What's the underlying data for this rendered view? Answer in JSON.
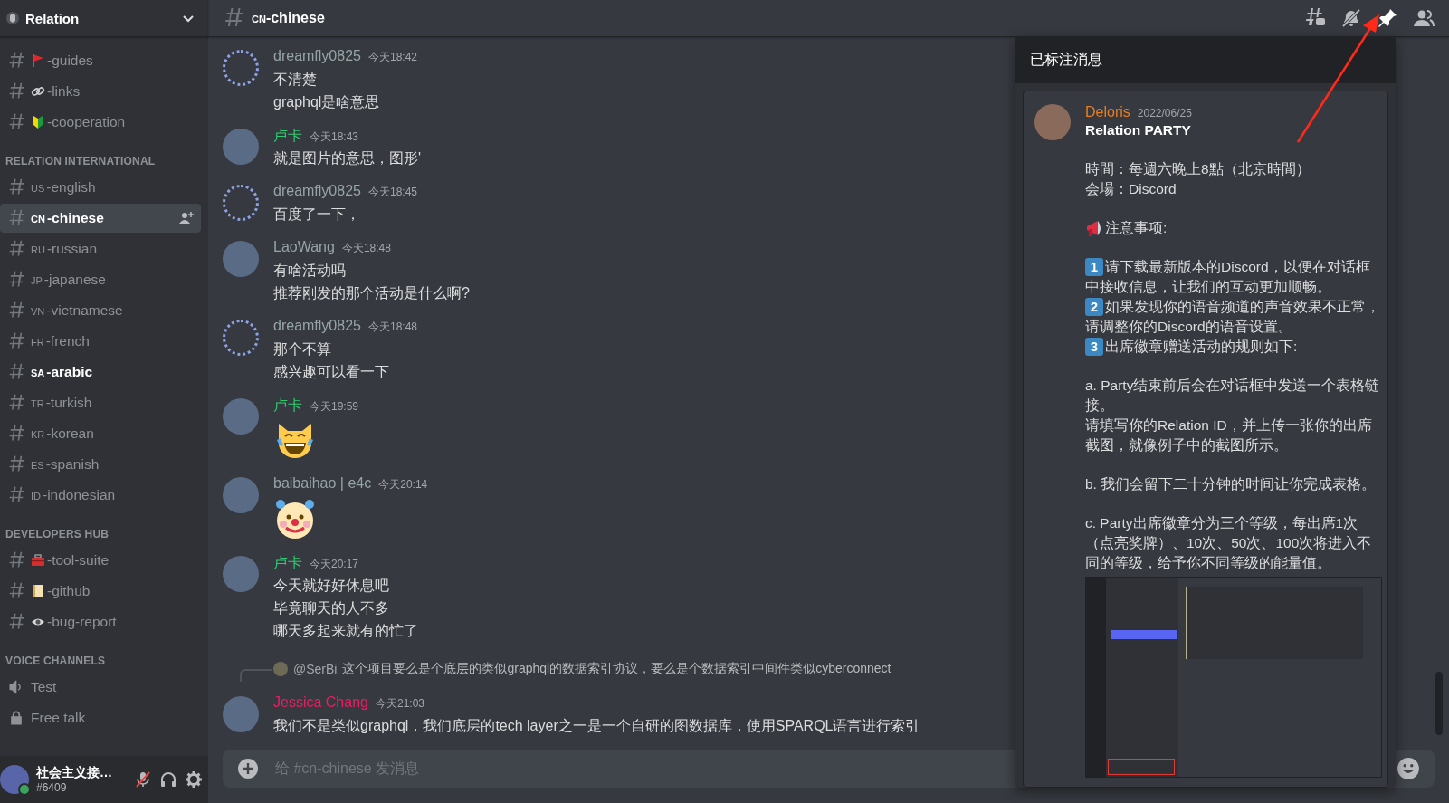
{
  "server": {
    "name": "Relation"
  },
  "sections": [
    {
      "channels": [
        {
          "kind": "text",
          "name": "-guides",
          "selected": false,
          "unread": false
        },
        {
          "kind": "text",
          "name": "-links",
          "selected": false,
          "unread": false
        },
        {
          "kind": "text",
          "name": "-cooperation",
          "selected": false,
          "unread": false
        }
      ]
    },
    {
      "title": "RELATION INTERNATIONAL",
      "channels": [
        {
          "kind": "text",
          "prefix": "us",
          "name": "-english",
          "selected": false,
          "unread": false
        },
        {
          "kind": "text",
          "prefix": "cn",
          "name": "-chinese",
          "selected": true,
          "unread": true
        },
        {
          "kind": "text",
          "prefix": "ru",
          "name": "-russian",
          "selected": false,
          "unread": false
        },
        {
          "kind": "text",
          "prefix": "jp",
          "name": "-japanese",
          "selected": false,
          "unread": false
        },
        {
          "kind": "text",
          "prefix": "vn",
          "name": "-vietnamese",
          "selected": false,
          "unread": false
        },
        {
          "kind": "text",
          "prefix": "fr",
          "name": "-french",
          "selected": false,
          "unread": false
        },
        {
          "kind": "text",
          "prefix": "sa",
          "name": "-arabic",
          "selected": false,
          "unread": true
        },
        {
          "kind": "text",
          "prefix": "tr",
          "name": "-turkish",
          "selected": false,
          "unread": false
        },
        {
          "kind": "text",
          "prefix": "kr",
          "name": "-korean",
          "selected": false,
          "unread": false
        },
        {
          "kind": "text",
          "prefix": "es",
          "name": "-spanish",
          "selected": false,
          "unread": false
        },
        {
          "kind": "text",
          "prefix": "id",
          "name": "-indonesian",
          "selected": false,
          "unread": false
        }
      ]
    },
    {
      "title": "DEVELOPERS HUB",
      "channels": [
        {
          "kind": "text",
          "name": "-tool-suite",
          "selected": false,
          "unread": false
        },
        {
          "kind": "text",
          "name": "-github",
          "selected": false,
          "unread": false
        },
        {
          "kind": "text",
          "name": "-bug-report",
          "selected": false,
          "unread": false
        }
      ]
    },
    {
      "title": "VOICE CHANNELS",
      "channels": [
        {
          "kind": "voice",
          "name": "Test",
          "selected": false,
          "unread": false
        },
        {
          "kind": "locked",
          "name": "Free talk",
          "selected": false,
          "unread": false
        }
      ]
    }
  ],
  "user": {
    "name": "社会主义接…",
    "tag": "#6409",
    "muted": true
  },
  "channel_header": {
    "prefix": "cn",
    "name": "-chinese",
    "pins_open": true
  },
  "messages": [
    {
      "author": "dreamfly0825",
      "color": "#95a5a6",
      "ring_avatar": true,
      "time": "今天18:42",
      "kind": "text",
      "lines": [
        "不清楚",
        "graphql是啥意思"
      ]
    },
    {
      "author": "卢卡",
      "color": "#2ecc71",
      "ring_avatar": false,
      "time": "今天18:43",
      "kind": "text",
      "lines": [
        "就是图片的意思，图形'"
      ]
    },
    {
      "author": "dreamfly0825",
      "color": "#95a5a6",
      "ring_avatar": true,
      "time": "今天18:45",
      "kind": "text",
      "lines": [
        "百度了一下，"
      ]
    },
    {
      "author": "LaoWang",
      "color": "#95a5a6",
      "ring_avatar": false,
      "time": "今天18:48",
      "kind": "text",
      "lines": [
        "有啥活动吗",
        "推荐刚发的那个活动是什么啊?"
      ]
    },
    {
      "author": "dreamfly0825",
      "color": "#95a5a6",
      "ring_avatar": true,
      "time": "今天18:48",
      "kind": "text",
      "lines": [
        "那个不算",
        "感兴趣可以看一下"
      ]
    },
    {
      "author": "卢卡",
      "color": "#2ecc71",
      "ring_avatar": false,
      "time": "今天19:59",
      "kind": "emoji"
    },
    {
      "author": "baibaihao | e4c",
      "color": "#95a5a6",
      "ring_avatar": false,
      "time": "今天20:14",
      "kind": "emoji"
    },
    {
      "author": "卢卡",
      "color": "#2ecc71",
      "ring_avatar": false,
      "time": "今天20:17",
      "kind": "text",
      "lines": [
        "今天就好好休息吧",
        "毕竟聊天的人不多",
        "哪天多起来就有的忙了"
      ]
    },
    {
      "author": "Jessica Chang",
      "color": "#e91e63",
      "ring_avatar": false,
      "time": "今天21:03",
      "kind": "text",
      "reply": {
        "author": "@SerBi",
        "text": "这个项目要么是个底层的类似graphql的数据索引协议，要么是个数据索引中间件类似cyberconnect"
      },
      "lines": [
        "我们不是类似graphql，我们底层的tech layer之一是一个自研的图数据库，使用SPARQL语言进行索引"
      ]
    }
  ],
  "composer": {
    "placeholder": "给 #cn-chinese 发消息"
  },
  "pinned": {
    "title": "已标注消息",
    "message": {
      "author": "Deloris",
      "color": "#e67e22",
      "date": "2022/06/25",
      "heading": "Relation PARTY",
      "blocks": [
        {
          "kind": "para",
          "gap": true,
          "text": "時間：每週六晚上8點（北京時間）"
        },
        {
          "kind": "para",
          "gap": false,
          "text": "会場：Discord"
        },
        {
          "kind": "notice",
          "gap": true,
          "text": "注意事项:"
        },
        {
          "kind": "numbered",
          "gap": true,
          "number": "1",
          "text": "请下载最新版本的Discord，以便在对话框中接收信息，让我们的互动更加顺畅。"
        },
        {
          "kind": "numbered",
          "gap": false,
          "number": "2",
          "text": "如果发现你的语音频道的声音效果不正常，请调整你的Discord的语音设置。"
        },
        {
          "kind": "numbered",
          "gap": false,
          "number": "3",
          "text": "出席徽章赠送活动的规则如下:"
        },
        {
          "kind": "para",
          "gap": true,
          "text": "a. Party结束前后会在对话框中发送一个表格链接。"
        },
        {
          "kind": "para",
          "gap": false,
          "text": "请填写你的Relation ID，并上传一张你的出席截图，就像例子中的截图所示。"
        },
        {
          "kind": "para",
          "gap": true,
          "text": "b. 我们会留下二十分钟的时间让你完成表格。"
        },
        {
          "kind": "para",
          "gap": true,
          "text": "c. Party出席徽章分为三个等级，每出席1次（点亮奖牌）、10次、50次、100次将进入不同的等级，给予你不同等级的能量值。"
        },
        {
          "kind": "screenshot"
        }
      ]
    }
  }
}
